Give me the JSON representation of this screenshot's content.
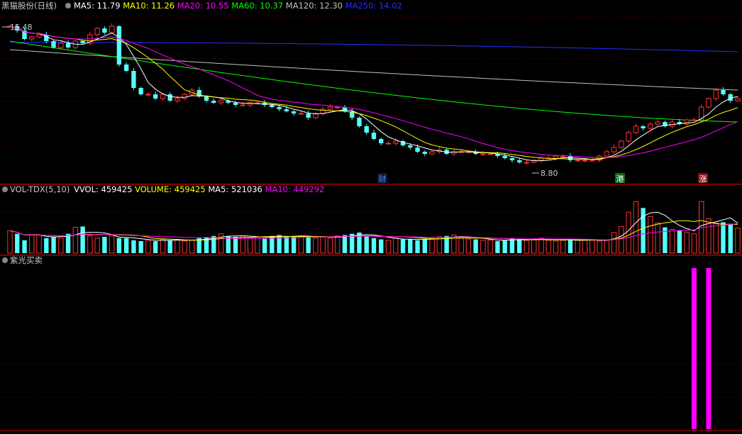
{
  "panes": {
    "price": {
      "title": "黑猫股份(日线)",
      "ma": [
        {
          "label": "MA5: 11.79",
          "color": "#ffffff"
        },
        {
          "label": "MA10: 11.26",
          "color": "#ffff00"
        },
        {
          "label": "MA20: 10.55",
          "color": "#ff00ff"
        },
        {
          "label": "MA60: 10.37",
          "color": "#00ff00"
        },
        {
          "label": "MA120: 12.30",
          "color": "#c0c0c0"
        },
        {
          "label": "MA250: 14.02",
          "color": "#2a2aff"
        }
      ],
      "high_label": "15.48",
      "low_label": "8.80",
      "events": [
        {
          "label": "财",
          "color": "#4a8cff",
          "bg": "#0a1a3a"
        },
        {
          "label": "港",
          "color": "#ffffff",
          "bg": "#0a6a1a"
        },
        {
          "label": "涨",
          "color": "#ffffff",
          "bg": "#8a1010"
        }
      ]
    },
    "volume": {
      "title": "VOL-TDX(5,10)",
      "items": [
        {
          "label": "VVOL: 459425",
          "color": "#ffffff"
        },
        {
          "label": "VOLUME: 459425",
          "color": "#ffff00"
        },
        {
          "label": "MA5: 521036",
          "color": "#ffffff"
        },
        {
          "label": "MA10: 449292",
          "color": "#ff00ff"
        }
      ]
    },
    "indicator": {
      "title": "紫光买卖"
    }
  },
  "colors": {
    "up": "#ff3232",
    "down": "#54ffff",
    "grid": "#7a0000",
    "separator": "#b00000",
    "text": "#c8c8c8",
    "signal": "#ff00ff"
  },
  "chart_data": {
    "type": "candlestick",
    "start_price": 15.3,
    "high": 15.48,
    "low": 8.8,
    "closes": [
      15.3,
      15.1,
      14.7,
      14.8,
      14.9,
      14.6,
      14.3,
      14.5,
      14.3,
      14.6,
      14.5,
      14.9,
      15.2,
      15.0,
      15.3,
      13.5,
      13.2,
      12.4,
      12.1,
      12.1,
      11.9,
      12.1,
      11.8,
      11.9,
      12.1,
      12.3,
      12.0,
      11.8,
      11.7,
      11.8,
      11.7,
      11.6,
      11.6,
      11.7,
      11.7,
      11.6,
      11.5,
      11.4,
      11.3,
      11.2,
      11.2,
      11.0,
      11.2,
      11.4,
      11.5,
      11.5,
      11.3,
      11.0,
      10.6,
      10.3,
      10.0,
      9.8,
      9.8,
      9.9,
      9.7,
      9.6,
      9.4,
      9.3,
      9.4,
      9.5,
      9.3,
      9.4,
      9.4,
      9.4,
      9.3,
      9.3,
      9.3,
      9.2,
      9.1,
      9.0,
      8.9,
      8.9,
      9.0,
      9.1,
      9.1,
      9.2,
      9.2,
      9.0,
      9.0,
      9.0,
      9.0,
      9.2,
      9.4,
      9.6,
      9.9,
      10.3,
      10.6,
      10.5,
      10.7,
      10.8,
      10.6,
      10.8,
      10.7,
      10.9,
      10.9,
      11.5,
      11.9,
      12.3,
      12.1,
      11.8,
      11.9
    ],
    "volumes": [
      52,
      45,
      30,
      43,
      42,
      35,
      38,
      35,
      45,
      60,
      62,
      40,
      35,
      38,
      40,
      35,
      35,
      30,
      28,
      30,
      28,
      32,
      30,
      32,
      28,
      30,
      35,
      37,
      40,
      45,
      40,
      38,
      40,
      35,
      38,
      35,
      40,
      42,
      38,
      40,
      40,
      38,
      35,
      38,
      35,
      40,
      42,
      45,
      48,
      40,
      35,
      32,
      30,
      35,
      32,
      33,
      30,
      32,
      35,
      38,
      40,
      42,
      36,
      33,
      32,
      30,
      30,
      28,
      30,
      35,
      32,
      30,
      32,
      35,
      30,
      28,
      30,
      32,
      30,
      31,
      30,
      28,
      30,
      48,
      62,
      95,
      120,
      105,
      85,
      70,
      60,
      55,
      52,
      48,
      45,
      120,
      80,
      70,
      72,
      68,
      58
    ],
    "signals": [
      94,
      96
    ],
    "ma_periods": [
      5,
      10,
      20,
      60,
      120,
      250
    ]
  }
}
